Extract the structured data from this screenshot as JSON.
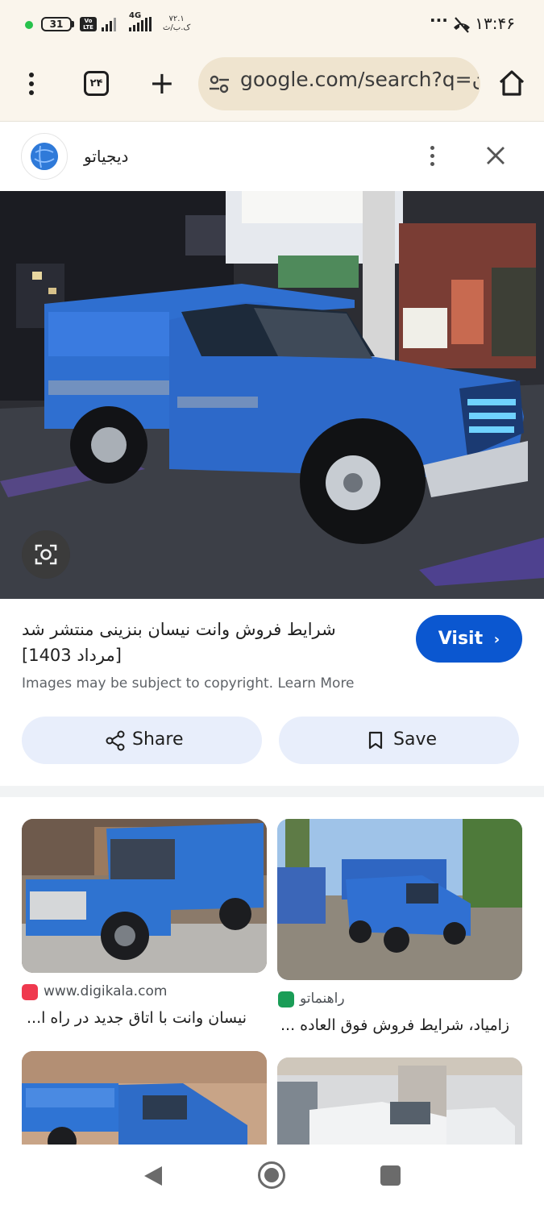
{
  "status_bar": {
    "battery": "31",
    "volte": "Vo LTE",
    "network": "4G",
    "speed_value": "۷۲.۱",
    "speed_unit": "ک.ب/ث",
    "overflow": "···",
    "time": "۱۳:۴۶"
  },
  "browser": {
    "tab_count": "۲۴",
    "url": "google.com/search?q=ن"
  },
  "panel": {
    "site_name": "دیجیاتو",
    "title": "شرایط فروش وانت نیسان بنزینی منتشر شد [مرداد 1403]",
    "visit_label": "Visit",
    "copyright_text": "Images may be subject to copyright.",
    "learn_more": "Learn More",
    "share_label": "Share",
    "save_label": "Save"
  },
  "results": [
    {
      "source": "www.digikala.com",
      "title": "نیسان وانت با اتاق جدید در راه ا...",
      "icon_color": "#ef394e"
    },
    {
      "source": "راهنماتو",
      "title": "زامیاد، شرایط فروش فوق العاده ...",
      "icon_color": "#1a9d57"
    }
  ],
  "colors": {
    "accent": "#0b57d0",
    "toolbar_bg": "#faf5ec",
    "pill_bg": "#e8eefb",
    "truck_blue": "#2f6fd0"
  },
  "icons": [
    "menu-dots-icon",
    "tabs-icon",
    "plus-icon",
    "tune-icon",
    "home-icon",
    "more-icon",
    "close-icon",
    "lens-icon",
    "chevron-right-icon",
    "share-icon",
    "bookmark-icon",
    "back-icon",
    "home-circle-icon",
    "recents-icon"
  ]
}
